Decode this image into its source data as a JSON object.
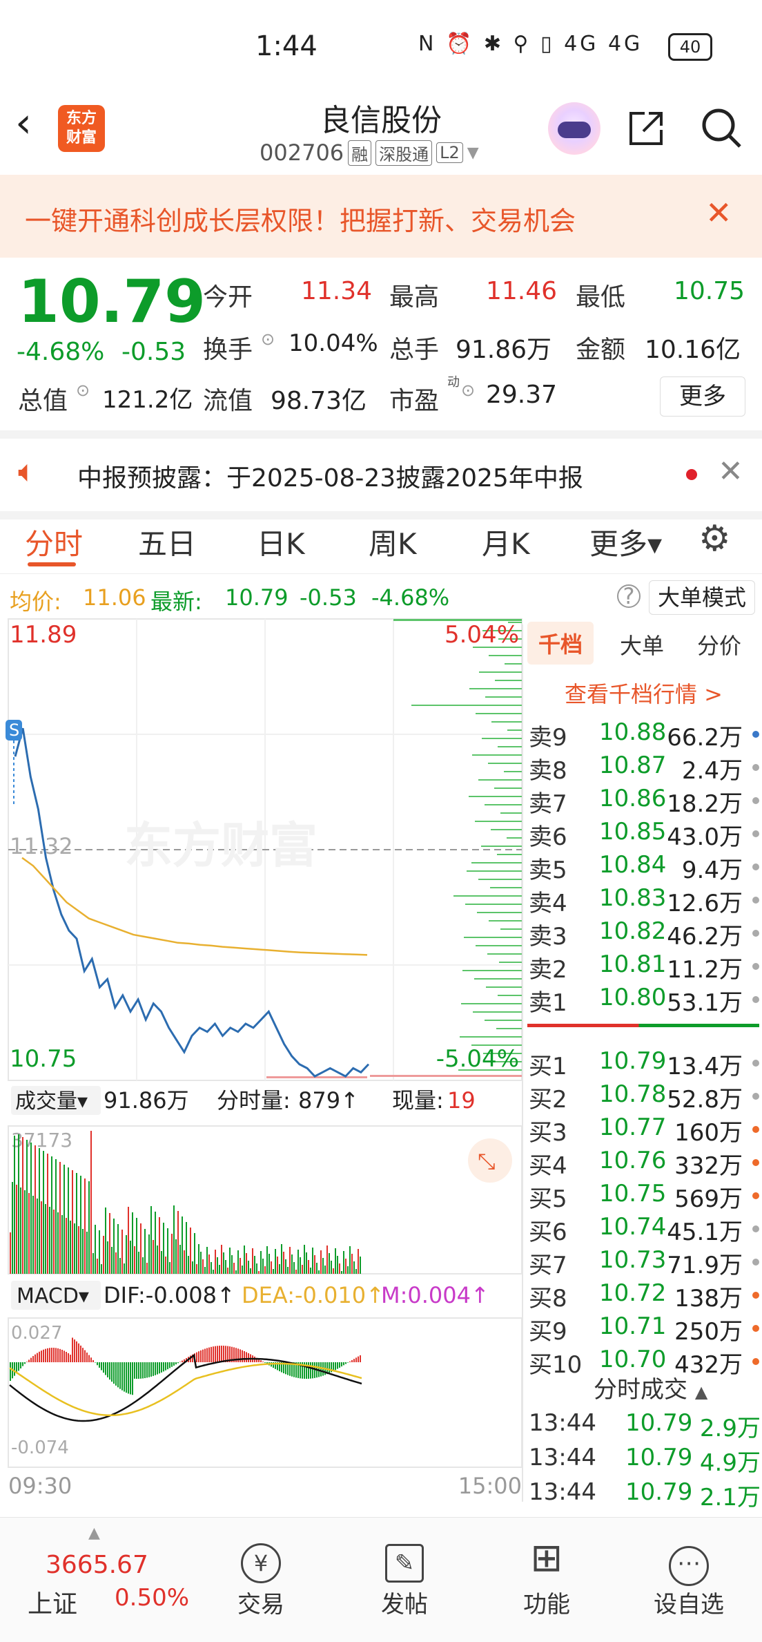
{
  "status": {
    "time": "1:44",
    "icons": "N ⏰ ✱ ⚲ ▯ 4G 4G",
    "battery": "40"
  },
  "header": {
    "logo_line1": "东方",
    "logo_line2": "财富",
    "stock_name": "良信股份",
    "stock_code": "002706",
    "tags": [
      "融",
      "深股通",
      "L2"
    ]
  },
  "banner": {
    "text": "一键开通科创成长层权限！把握打新、交易机会"
  },
  "quote": {
    "price": "10.79",
    "change_pct": "-4.68%",
    "change": "-0.53",
    "open_label": "今开",
    "open": "11.34",
    "high_label": "最高",
    "high": "11.46",
    "low_label": "最低",
    "low": "10.75",
    "turnover_label": "换手",
    "turnover": "10.04%",
    "volume_label": "总手",
    "volume": "91.86万",
    "amount_label": "金额",
    "amount": "10.16亿",
    "mktcap_label": "总值",
    "mktcap": "121.2亿",
    "float_label": "流值",
    "float": "98.73亿",
    "pe_label": "市盈",
    "pe_sup": "动",
    "pe": "29.37",
    "more_label": "更多"
  },
  "notice": {
    "text": "中报预披露：于2025-08-23披露2025年中报"
  },
  "tabs": [
    "分时",
    "五日",
    "日K",
    "周K",
    "月K",
    "更多▾"
  ],
  "avgbar": {
    "avg_label": "均价:",
    "avg": "11.06",
    "latest_label": "最新:",
    "latest": "10.79",
    "change": "-0.53",
    "change_pct": "-4.68%",
    "help": "?",
    "bigmode": "大单模式"
  },
  "chart_data": {
    "type": "line",
    "y_top": "11.89",
    "y_bottom": "10.75",
    "y_mid": "11.32",
    "pct_top": "5.04%",
    "pct_bottom": "-5.04%",
    "watermark": "东方财富",
    "x_start": "09:30",
    "x_end": "15:00",
    "price_line": [
      11.55,
      11.62,
      11.5,
      11.42,
      11.3,
      11.22,
      11.16,
      11.12,
      11.1,
      11.02,
      11.05,
      10.98,
      11.0,
      10.93,
      10.96,
      10.92,
      10.95,
      10.9,
      10.94,
      10.92,
      10.88,
      10.85,
      10.82,
      10.86,
      10.88,
      10.87,
      10.89,
      10.86,
      10.88,
      10.87,
      10.89,
      10.88,
      10.9,
      10.92,
      10.88,
      10.84,
      10.81,
      10.79,
      10.78,
      10.76,
      10.77,
      10.78,
      10.77,
      10.76,
      10.78,
      10.77,
      10.79
    ],
    "avg_line": [
      11.3,
      11.28,
      11.25,
      11.22,
      11.19,
      11.17,
      11.15,
      11.14,
      11.13,
      11.12,
      11.11,
      11.105,
      11.1,
      11.095,
      11.09,
      11.088,
      11.085,
      11.083,
      11.08,
      11.078,
      11.076,
      11.074,
      11.072,
      11.07,
      11.068,
      11.066,
      11.065,
      11.064,
      11.063,
      11.062,
      11.061,
      11.06
    ],
    "volume_header": {
      "label": "成交量▾",
      "total": "91.86万",
      "minute_label": "分时量:",
      "minute": "879↑",
      "now_label": "现量:",
      "now": "19"
    },
    "volume_max": "37173",
    "macd_header": {
      "label": "MACD▾",
      "dif": "DIF:-0.008↑",
      "dea": "DEA:-0.010↑",
      "m": "M:0.004↑"
    },
    "macd_top": "0.027",
    "macd_bottom": "-0.074"
  },
  "orderbook": {
    "tabs": [
      "千档",
      "大单",
      "分价"
    ],
    "link": "查看千档行情 >",
    "asks": [
      {
        "label": "卖9",
        "price": "10.88",
        "vol": "66.2万",
        "dot": "#3a78c8"
      },
      {
        "label": "卖8",
        "price": "10.87",
        "vol": "2.4万",
        "dot": "#aaaaaa"
      },
      {
        "label": "卖7",
        "price": "10.86",
        "vol": "18.2万",
        "dot": "#aaaaaa"
      },
      {
        "label": "卖6",
        "price": "10.85",
        "vol": "43.0万",
        "dot": "#aaaaaa"
      },
      {
        "label": "卖5",
        "price": "10.84",
        "vol": "9.4万",
        "dot": "#aaaaaa"
      },
      {
        "label": "卖4",
        "price": "10.83",
        "vol": "12.6万",
        "dot": "#aaaaaa"
      },
      {
        "label": "卖3",
        "price": "10.82",
        "vol": "46.2万",
        "dot": "#aaaaaa"
      },
      {
        "label": "卖2",
        "price": "10.81",
        "vol": "11.2万",
        "dot": "#aaaaaa"
      },
      {
        "label": "卖1",
        "price": "10.80",
        "vol": "53.1万",
        "dot": "#aaaaaa"
      }
    ],
    "bids": [
      {
        "label": "买1",
        "price": "10.79",
        "vol": "13.4万",
        "dot": "#aaaaaa"
      },
      {
        "label": "买2",
        "price": "10.78",
        "vol": "52.8万",
        "dot": "#aaaaaa"
      },
      {
        "label": "买3",
        "price": "10.77",
        "vol": "160万",
        "dot": "#ee6a2a"
      },
      {
        "label": "买4",
        "price": "10.76",
        "vol": "332万",
        "dot": "#ee6a2a"
      },
      {
        "label": "买5",
        "price": "10.75",
        "vol": "569万",
        "dot": "#ee6a2a"
      },
      {
        "label": "买6",
        "price": "10.74",
        "vol": "45.1万",
        "dot": "#aaaaaa"
      },
      {
        "label": "买7",
        "price": "10.73",
        "vol": "71.9万",
        "dot": "#aaaaaa"
      },
      {
        "label": "买8",
        "price": "10.72",
        "vol": "138万",
        "dot": "#ee6a2a"
      },
      {
        "label": "买9",
        "price": "10.71",
        "vol": "250万",
        "dot": "#ee6a2a"
      },
      {
        "label": "买10",
        "price": "10.70",
        "vol": "432万",
        "dot": "#ee6a2a"
      }
    ],
    "ticks_title": "分时成交",
    "ticks": [
      {
        "time": "13:44",
        "price": "10.79",
        "vol": "2.9万"
      },
      {
        "time": "13:44",
        "price": "10.79",
        "vol": "4.9万"
      },
      {
        "time": "13:44",
        "price": "10.79",
        "vol": "2.1万"
      }
    ]
  },
  "bottom_nav": {
    "index_value": "3665.67",
    "index_name": "上证",
    "index_pct": "0.50%",
    "items": [
      {
        "label": "交易",
        "icon": "¥"
      },
      {
        "label": "发帖",
        "icon": "✎"
      },
      {
        "label": "功能",
        "icon": "⊞"
      },
      {
        "label": "设自选",
        "icon": "⋯"
      }
    ]
  },
  "colors": {
    "up": "#e0312b",
    "down": "#0d9c2a",
    "accent": "#e8562a",
    "price_line": "#2c6cb0",
    "avg_line": "#e8b030"
  }
}
